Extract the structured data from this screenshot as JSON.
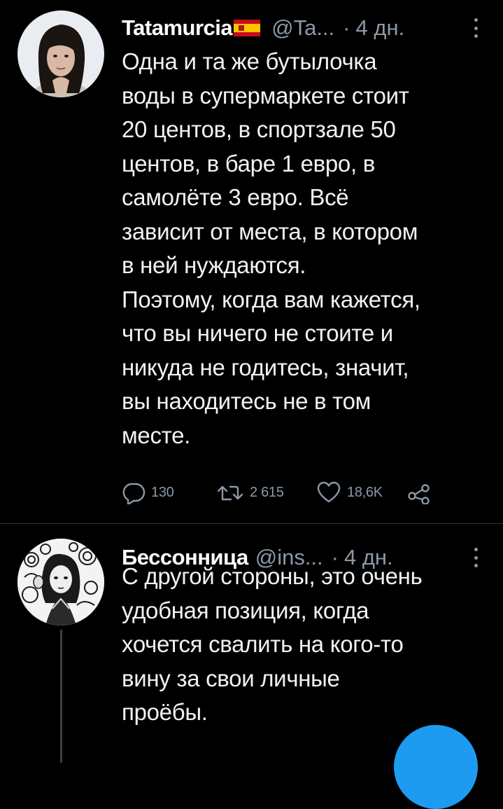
{
  "tweets": [
    {
      "display_name": "Tatamurcia",
      "handle": "@Ta...",
      "dot": "·",
      "time": "4 дн.",
      "text": "Одна и та же бутылочка\nводы в супермаркете стоит\n20 центов, в спортзале 50\nцентов, в баре 1 евро, в\nсамолёте 3 евро. Всё\nзависит от места, в котором\nв ней нуждаются.\nПоэтому, когда вам кажется,\nчто вы ничего не стоите и\nникуда не годитесь, значит,\nвы находитесь не в том\nместе.",
      "flag_icon": "spain-flag-icon",
      "replies": "130",
      "retweets": "2 615",
      "likes": "18,6K"
    },
    {
      "display_name": "Бессонница",
      "handle": "@ins...",
      "dot": "·",
      "time": "4 дн.",
      "text": "С другой стороны, это очень\nудобная позиция, когда\nхочется свалить на кого-то\nвину за свои личные\nпроёбы."
    }
  ],
  "icons": {
    "reply": "reply-icon",
    "retweet": "retweet-icon",
    "like": "like-icon",
    "share": "share-icon",
    "more": "more-icon"
  },
  "colors": {
    "background": "#000000",
    "text": "#e7e9ea",
    "secondary": "#8b98a5",
    "divider": "#2f3336",
    "accent": "#1d9bf0"
  }
}
